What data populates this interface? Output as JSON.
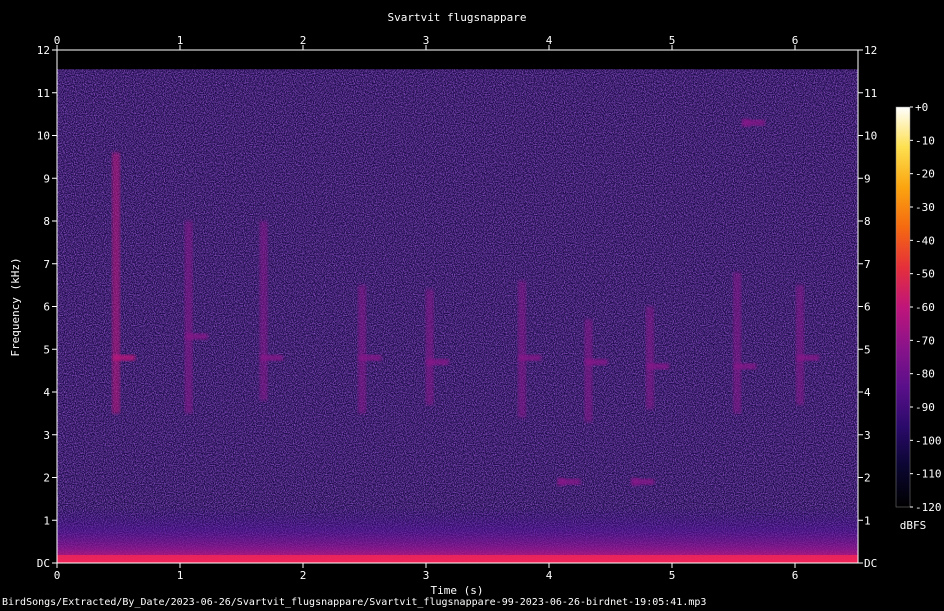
{
  "chart_data": {
    "type": "heatmap",
    "title": "Svartvit flugsnappare",
    "xlabel": "Time (s)",
    "ylabel": "Frequency (kHz)",
    "xlim": [
      0,
      6.5
    ],
    "ylim": [
      0,
      12
    ],
    "x_ticks": [
      "0",
      "1",
      "2",
      "3",
      "4",
      "5",
      "6"
    ],
    "y_ticks": [
      "DC",
      "1",
      "2",
      "3",
      "4",
      "5",
      "6",
      "7",
      "8",
      "9",
      "10",
      "11",
      "12"
    ],
    "colorbar": {
      "unit": "dBFS",
      "range": [
        -120,
        0
      ],
      "ticks": [
        "+0",
        "-10",
        "-20",
        "-30",
        "-40",
        "-50",
        "-60",
        "-70",
        "-80",
        "-90",
        "-100",
        "-110",
        "-120"
      ],
      "colors": [
        "#000000",
        "#0a0630",
        "#2a0a6a",
        "#5a0f8a",
        "#8a138a",
        "#c0157a",
        "#e5303a",
        "#f56a10",
        "#fba510",
        "#fde050",
        "#ffffff"
      ]
    },
    "events": [
      {
        "t": 0.48,
        "f_low": 3.5,
        "f_high": 9.6,
        "peak_khz": 4.8,
        "level_db": -72
      },
      {
        "t": 1.07,
        "f_low": 3.5,
        "f_high": 8.0,
        "peak_khz": 5.3,
        "level_db": -74
      },
      {
        "t": 1.68,
        "f_low": 3.8,
        "f_high": 8.0,
        "peak_khz": 4.8,
        "level_db": -74
      },
      {
        "t": 2.48,
        "f_low": 3.5,
        "f_high": 6.5,
        "peak_khz": 4.8,
        "level_db": -76
      },
      {
        "t": 3.03,
        "f_low": 3.7,
        "f_high": 6.4,
        "peak_khz": 4.7,
        "level_db": -75
      },
      {
        "t": 3.78,
        "f_low": 3.4,
        "f_high": 6.6,
        "peak_khz": 4.8,
        "level_db": -74
      },
      {
        "t": 4.32,
        "f_low": 3.3,
        "f_high": 5.7,
        "peak_khz": 4.7,
        "level_db": -77
      },
      {
        "t": 4.82,
        "f_low": 3.6,
        "f_high": 6.0,
        "peak_khz": 4.6,
        "level_db": -78
      },
      {
        "t": 5.53,
        "f_low": 3.5,
        "f_high": 6.8,
        "peak_khz": 4.6,
        "level_db": -74
      },
      {
        "t": 6.04,
        "f_low": 3.7,
        "f_high": 6.5,
        "peak_khz": 4.8,
        "level_db": -78
      },
      {
        "t": 4.1,
        "f_low": 1.8,
        "f_high": 2.0,
        "peak_khz": 1.9,
        "level_db": -80
      },
      {
        "t": 4.7,
        "f_low": 1.8,
        "f_high": 2.0,
        "peak_khz": 1.9,
        "level_db": -82
      },
      {
        "t": 5.6,
        "f_low": 10.2,
        "f_high": 10.4,
        "peak_khz": 10.3,
        "level_db": -80
      }
    ]
  },
  "footer": "BirdSongs/Extracted/By_Date/2023-06-26/Svartvit_flugsnappare/Svartvit_flugsnappare-99-2023-06-26-birdnet-19:05:41.mp3"
}
